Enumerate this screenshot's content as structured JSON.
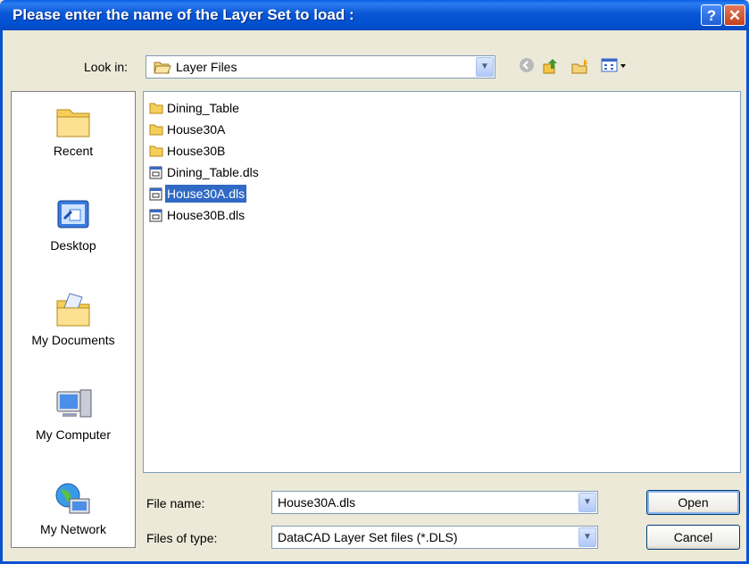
{
  "window": {
    "title": "Please enter the name of the Layer Set to load :",
    "help_label": "?",
    "close_label": "✕"
  },
  "lookin": {
    "label": "Look in:",
    "value": "Layer Files"
  },
  "toolbar": {
    "back_icon": "back-arrow-icon",
    "up_icon": "up-folder-icon",
    "new_folder_icon": "new-folder-icon",
    "views_icon": "views-menu-icon"
  },
  "places": [
    {
      "label": "Recent",
      "icon": "recent-folder-icon"
    },
    {
      "label": "Desktop",
      "icon": "desktop-icon"
    },
    {
      "label": "My Documents",
      "icon": "my-documents-icon"
    },
    {
      "label": "My Computer",
      "icon": "my-computer-icon"
    },
    {
      "label": "My Network",
      "icon": "my-network-icon"
    }
  ],
  "files": [
    {
      "name": "Dining_Table",
      "type": "folder"
    },
    {
      "name": "House30A",
      "type": "folder"
    },
    {
      "name": "House30B",
      "type": "folder"
    },
    {
      "name": "Dining_Table.dls",
      "type": "file"
    },
    {
      "name": "House30A.dls",
      "type": "file",
      "selected": true
    },
    {
      "name": "House30B.dls",
      "type": "file"
    }
  ],
  "filename": {
    "label": "File name:",
    "value": "House30A.dls"
  },
  "filetype": {
    "label": "Files of type:",
    "value": "DataCAD Layer Set files (*.DLS)"
  },
  "buttons": {
    "open": "Open",
    "cancel": "Cancel"
  },
  "colors": {
    "titlebar": "#0a57d6",
    "selection": "#316ac5",
    "dialog_bg": "#ece9d8"
  }
}
